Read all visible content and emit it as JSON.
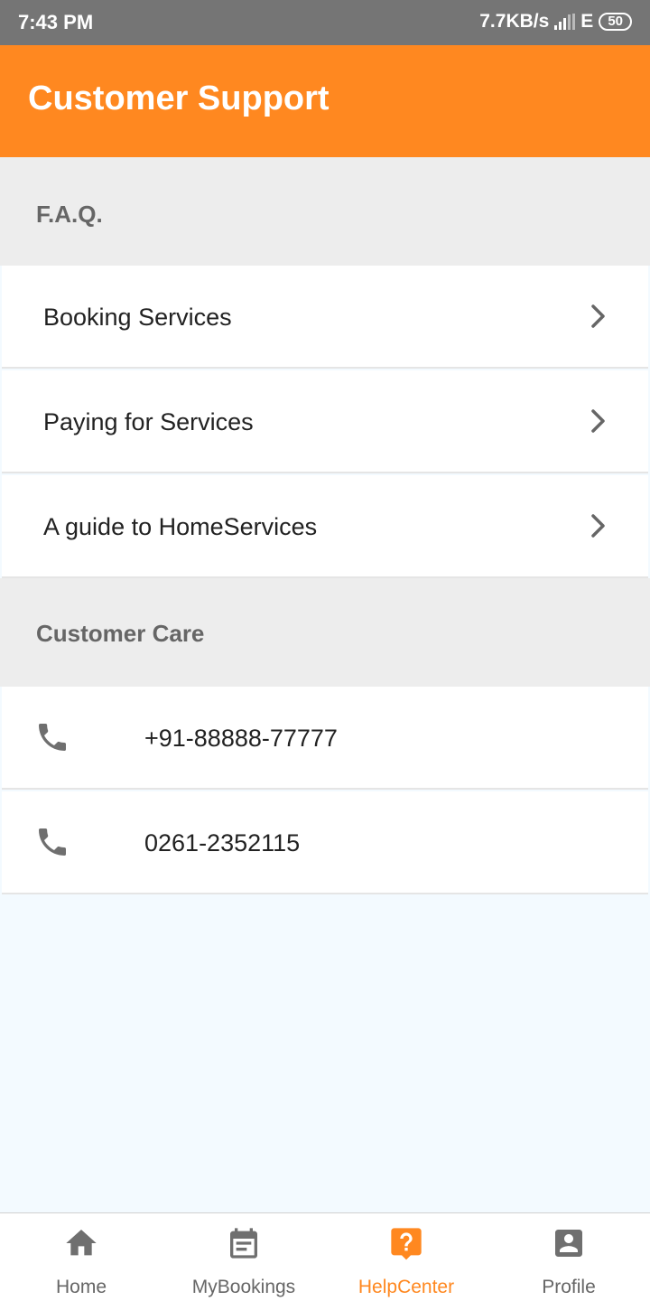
{
  "status_bar": {
    "time": "7:43 PM",
    "network_speed": "7.7KB/s",
    "network_type": "E",
    "battery": "50"
  },
  "app_bar": {
    "title": "Customer Support"
  },
  "faq": {
    "header": "F.A.Q.",
    "items": [
      {
        "label": "Booking Services"
      },
      {
        "label": "Paying for Services"
      },
      {
        "label": "A guide to HomeServices"
      }
    ]
  },
  "customer_care": {
    "header": "Customer Care",
    "phones": [
      {
        "number": "+91-88888-77777"
      },
      {
        "number": "0261-2352115"
      }
    ]
  },
  "bottom_nav": {
    "items": [
      {
        "label": "Home",
        "icon": "home-icon"
      },
      {
        "label": "MyBookings",
        "icon": "calendar-icon"
      },
      {
        "label": "HelpCenter",
        "icon": "help-icon",
        "active": true
      },
      {
        "label": "Profile",
        "icon": "profile-icon"
      }
    ]
  },
  "colors": {
    "accent": "#ff8820",
    "status_bar": "#757575",
    "section_bg": "#ededed",
    "page_bg": "#f3faff"
  }
}
